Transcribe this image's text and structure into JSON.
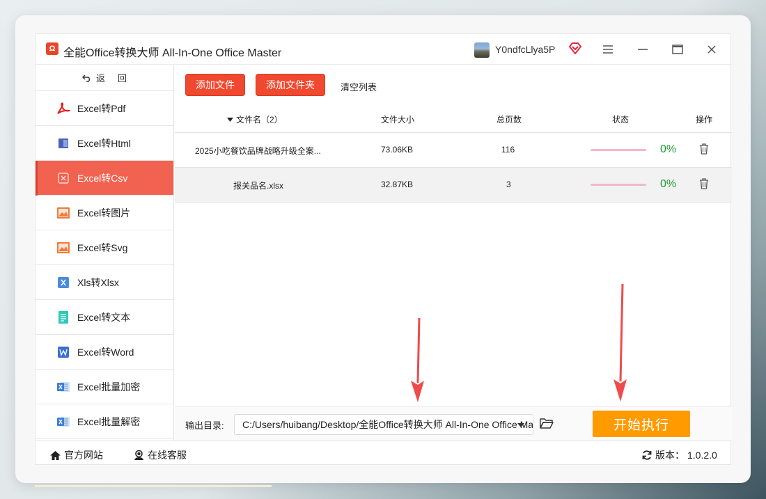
{
  "window": {
    "logo_text": "Ω",
    "title": "全能Office转换大师 All-In-One Office Master",
    "username": "Y0ndfcLlya5P"
  },
  "sidebar": {
    "back_label": "返回",
    "items": [
      {
        "label": "Excel转Pdf",
        "icon": "pdf-icon"
      },
      {
        "label": "Excel转Html",
        "icon": "html-icon"
      },
      {
        "label": "Excel转Csv",
        "icon": "csv-icon",
        "active": true
      },
      {
        "label": "Excel转图片",
        "icon": "image-icon"
      },
      {
        "label": "Excel转Svg",
        "icon": "svg-image-icon"
      },
      {
        "label": "Xls转Xlsx",
        "icon": "xls-icon"
      },
      {
        "label": "Excel转文本",
        "icon": "text-icon"
      },
      {
        "label": "Excel转Word",
        "icon": "word-icon"
      },
      {
        "label": "Excel批量加密",
        "icon": "excel-icon"
      },
      {
        "label": "Excel批量解密",
        "icon": "excel-icon"
      }
    ]
  },
  "toolbar": {
    "add_file": "添加文件",
    "add_folder": "添加文件夹",
    "clear_list": "清空列表"
  },
  "table": {
    "columns": [
      "文件名（2）",
      "文件大小",
      "总页数",
      "状态",
      "操作"
    ],
    "rows": [
      {
        "name": "2025小吃餐饮品牌战略升级全案...",
        "size": "73.06KB",
        "pages": "116",
        "status": "0%",
        "progress": 0
      },
      {
        "name": "报关品名.xlsx",
        "size": "32.87KB",
        "pages": "3",
        "status": "0%",
        "progress": 0
      }
    ]
  },
  "output": {
    "label": "输出目录:",
    "path": "C:/Users/huibang/Desktop/全能Office转换大师 All-In-One Office Master",
    "start_label": "开始执行"
  },
  "footer": {
    "website": "官方网站",
    "support": "在线客服",
    "version_label": "版本：",
    "version": "1.0.2.0"
  },
  "colors": {
    "accent": "#f26250",
    "button_red": "#f0492f",
    "start_orange": "#ff9a00",
    "progress_green": "#1c9b2c",
    "annotation_arrow": "#f04a4a"
  }
}
